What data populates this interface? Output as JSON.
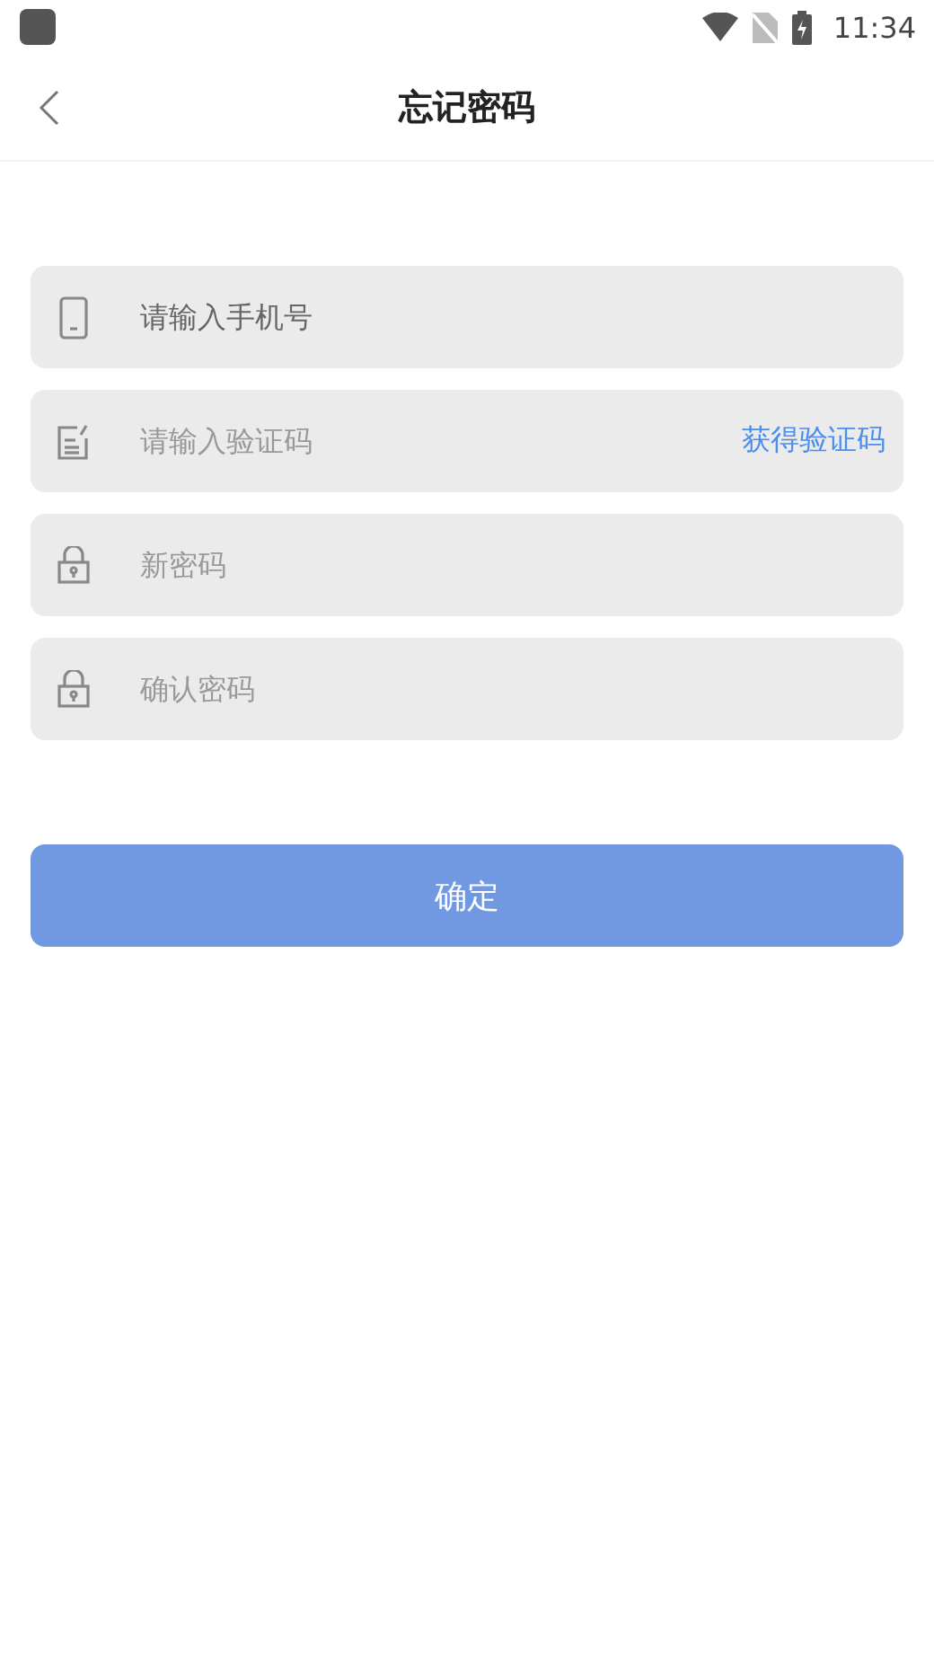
{
  "status_bar": {
    "time": "11:34"
  },
  "header": {
    "title": "忘记密码"
  },
  "fields": [
    {
      "kind": "phone",
      "placeholder": "请输入手机号"
    },
    {
      "kind": "code",
      "placeholder": "请输入验证码",
      "action": "获得验证码"
    },
    {
      "kind": "lock",
      "placeholder": "新密码"
    },
    {
      "kind": "lock",
      "placeholder": "确认密码"
    }
  ],
  "submit": {
    "label": "确定"
  }
}
